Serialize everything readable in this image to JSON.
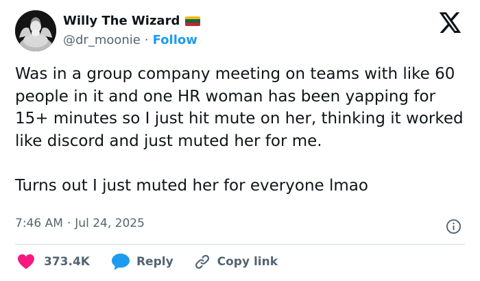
{
  "author": {
    "display_name": "Willy The Wizard",
    "handle": "@dr_moonie",
    "separator": "·",
    "follow_label": "Follow",
    "flag_colors": [
      "#fdb913",
      "#006a44",
      "#c1272d"
    ]
  },
  "tweet": {
    "text": "Was in a group company meeting on teams with like 60 people in it and one HR woman has been yapping for 15+ minutes so I just hit mute on her, thinking it worked like discord and just muted her for me.\n\nTurns out I just muted her for everyone lmao",
    "time": "7:46 AM",
    "meta_separator": "·",
    "date": "Jul 24, 2025"
  },
  "actions": {
    "likes": "373.4K",
    "reply_label": "Reply",
    "copy_label": "Copy link"
  },
  "colors": {
    "text": "#0f1419",
    "secondary": "#536471",
    "accent": "#1d9bf0",
    "like": "#f91880",
    "divider": "#cfd9de"
  },
  "icons": {
    "brand": "x-logo-icon",
    "info": "info-icon",
    "like": "heart-icon",
    "reply": "speech-bubble-icon",
    "copy": "link-icon"
  }
}
